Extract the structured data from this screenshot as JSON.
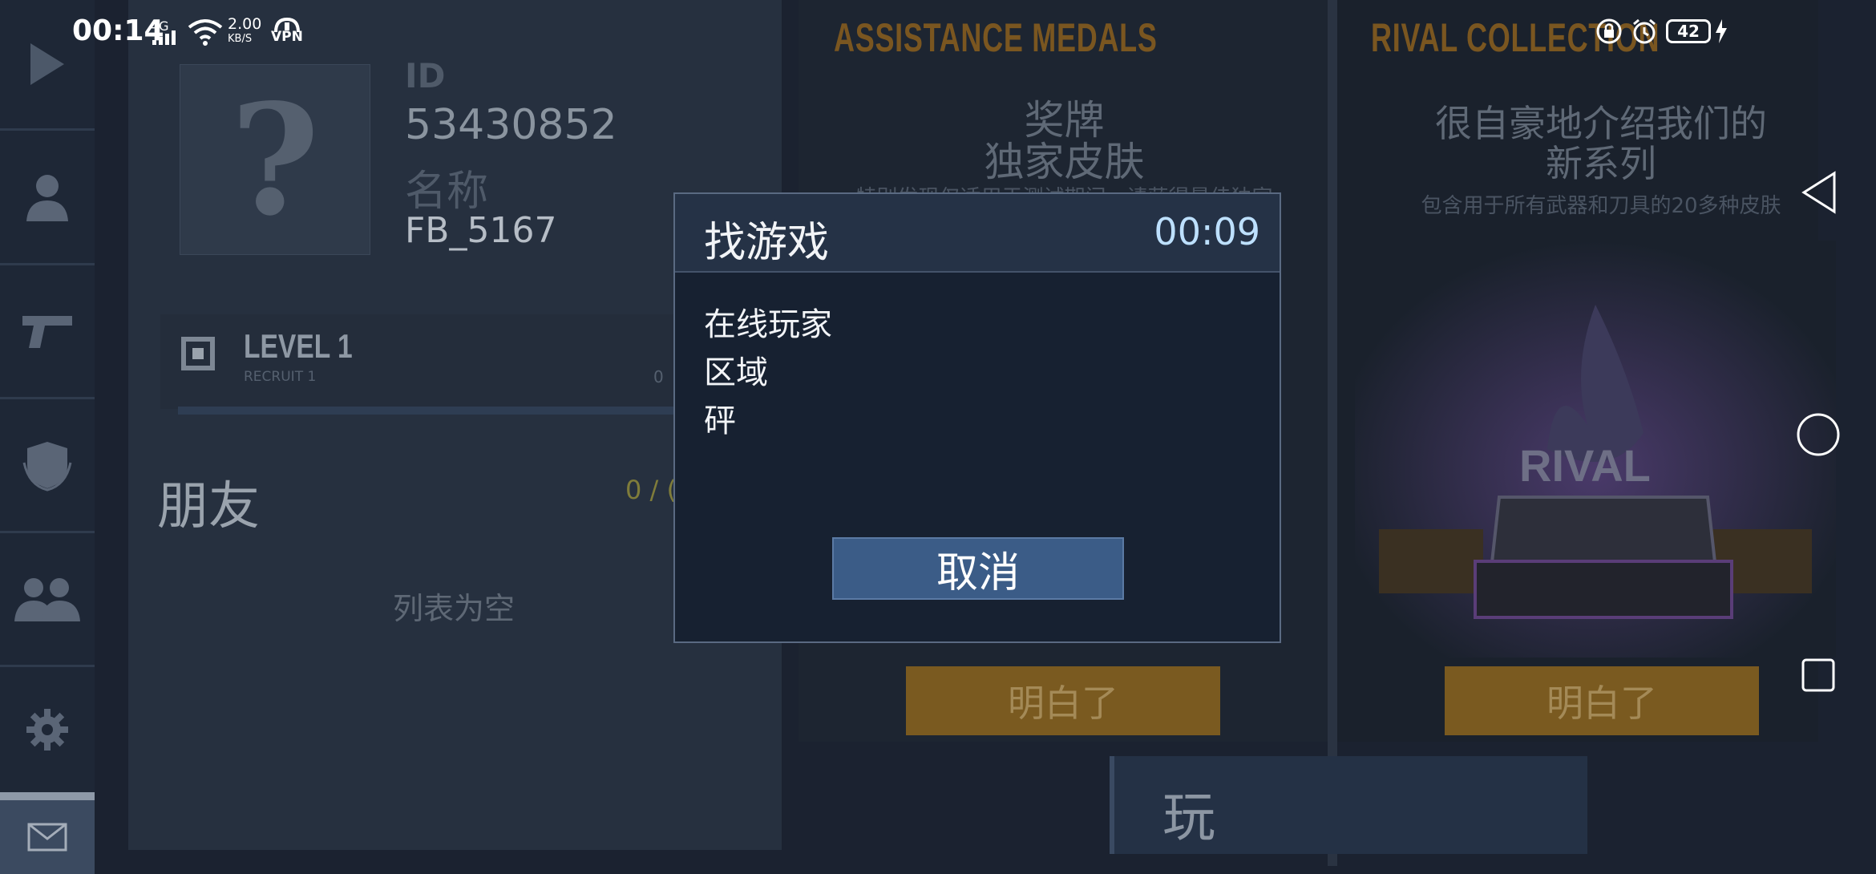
{
  "status_bar": {
    "time": "00:14",
    "network": "4G",
    "speed_value": "2.00",
    "speed_unit": "KB/S",
    "vpn": "VPN",
    "battery": "42"
  },
  "profile": {
    "avatar_placeholder": "?",
    "id_label": "ID",
    "id_value": "53430852",
    "name_label": "名称",
    "name_value": "FB_5167",
    "level_title": "LEVEL 1",
    "level_subtitle": "RECRUIT 1",
    "level_xp": "0",
    "friends_title": "朋友",
    "friends_count": "0 / (",
    "friends_empty": "列表为空"
  },
  "medals_card": {
    "header": "ASSISTANCE MEDALS",
    "line1": "奖牌",
    "line2": "独家皮肤",
    "description": "特别发现仅适用于测试期间，请获得最佳独家",
    "button": "明白了"
  },
  "rival_card": {
    "header": "RIVAL COLLECTION",
    "line1": "很自豪地介绍我们的",
    "line2": "新系列",
    "description": "包含用于所有武器和刀具的20多种皮肤",
    "art_text": "RIVAL",
    "button": "明白了"
  },
  "play_button": {
    "label": "玩"
  },
  "modal": {
    "title": "找游戏",
    "timer": "00:09",
    "lines": [
      "在线玩家",
      "区域",
      "砰"
    ],
    "cancel": "取消"
  },
  "icons": {
    "sidebar": [
      "play-icon",
      "profile-icon",
      "pistol-icon",
      "shield-icon",
      "friends-icon",
      "gear-icon",
      "mail-icon"
    ],
    "nav": [
      "back-triangle-icon",
      "home-circle-icon",
      "recents-square-icon"
    ]
  },
  "colors": {
    "modal_bg": "#172131",
    "modal_header": "#253246",
    "cancel_button": "#3b5c87",
    "timer": "#bde0ff",
    "accent_gold": "#7a5620"
  }
}
